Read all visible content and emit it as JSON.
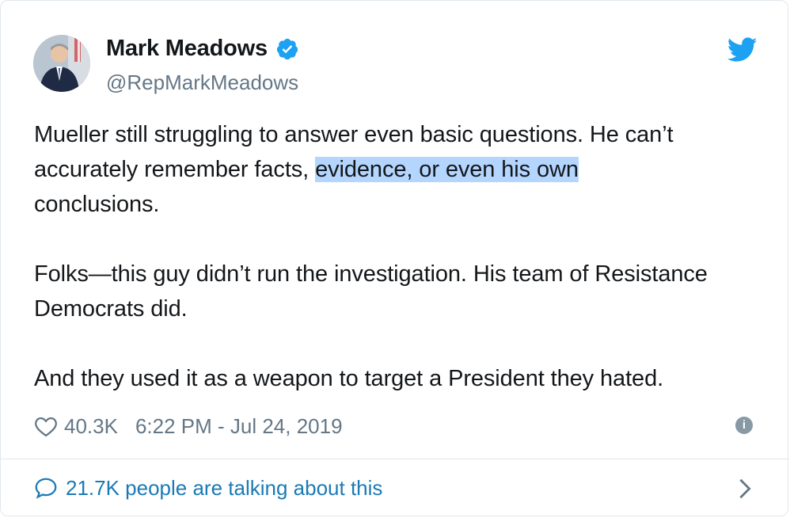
{
  "author": {
    "name": "Mark Meadows",
    "handle": "@RepMarkMeadows",
    "verified": true,
    "avatar_icon": "profile-photo"
  },
  "tweet": {
    "line1": "Mueller still struggling to answer even basic questions. He can’t",
    "line2_before": "accurately remember facts, ",
    "line2_highlight": "evidence, or even his own ",
    "line3": "conclusions.",
    "paragraph2": "Folks—this guy didn’t run the investigation. His team of Resistance Democrats did.",
    "paragraph3": "And they used it as a weapon to target a President they hated."
  },
  "meta": {
    "likes": "40.3K",
    "timestamp": "6:22 PM - Jul 24, 2019"
  },
  "footer": {
    "talking": "21.7K people are talking about this"
  },
  "colors": {
    "brand": "#1da1f2",
    "link": "#1b7ab5",
    "secondary_text": "#657786",
    "highlight": "#b4d5fe"
  }
}
